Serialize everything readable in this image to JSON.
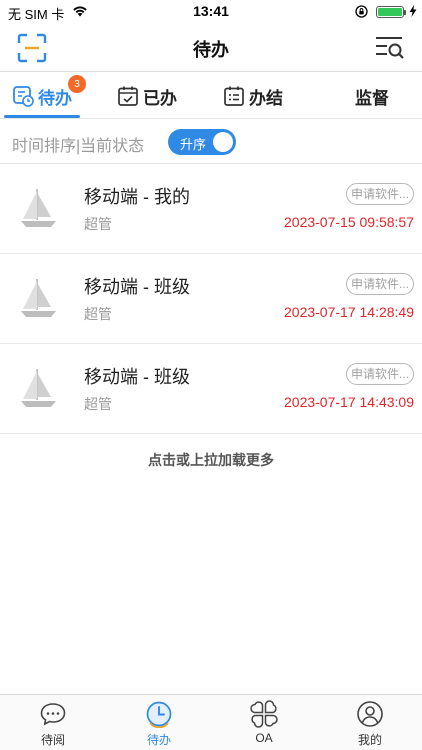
{
  "status_bar": {
    "carrier": "无 SIM 卡",
    "time": "13:41",
    "battery_level": 1.0
  },
  "nav": {
    "title": "待办",
    "left_icon": "scan-icon",
    "right_icon": "search-list-icon"
  },
  "tabs": [
    {
      "label": "待办",
      "icon": "todo-icon",
      "active": true,
      "badge": "3"
    },
    {
      "label": "已办",
      "icon": "calendar-check-icon",
      "active": false
    },
    {
      "label": "办结",
      "icon": "calendar-list-icon",
      "active": false
    },
    {
      "label": "监督",
      "active": false
    }
  ],
  "sort": {
    "label": "时间排序|当前状态",
    "toggle_label": "升序",
    "toggle_on": true
  },
  "items": [
    {
      "title": "移动端 - 我的",
      "user": "超管",
      "tag": "申请软件...",
      "time": "2023-07-15 09:58:57",
      "icon": "sailboat-icon"
    },
    {
      "title": "移动端 - 班级",
      "user": "超管",
      "tag": "申请软件...",
      "time": "2023-07-17 14:28:49",
      "icon": "sailboat-icon"
    },
    {
      "title": "移动端 - 班级",
      "user": "超管",
      "tag": "申请软件...",
      "time": "2023-07-17 14:43:09",
      "icon": "sailboat-icon"
    }
  ],
  "load_more": "点击或上拉加载更多",
  "tabbar": [
    {
      "label": "待阅",
      "icon": "chat-bubble-icon",
      "active": false
    },
    {
      "label": "待办",
      "icon": "clock-icon",
      "active": true
    },
    {
      "label": "OA",
      "icon": "apps-icon",
      "active": false
    },
    {
      "label": "我的",
      "icon": "user-icon",
      "active": false
    }
  ],
  "colors": {
    "accent": "#2f8ae6",
    "badge": "#f56a2a",
    "timestamp": "#e0262b",
    "battery": "#34c759"
  }
}
